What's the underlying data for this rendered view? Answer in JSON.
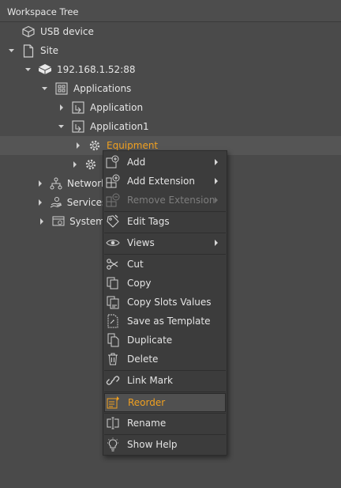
{
  "panel": {
    "title": "Workspace Tree"
  },
  "tree": {
    "usb_device": "USB device",
    "site": "Site",
    "device_ip": "192.168.1.52:88",
    "applications": "Applications",
    "application": "Application",
    "application1": "Application1",
    "equipment": "Equipment",
    "network": "Network",
    "services": "Services",
    "system": "System"
  },
  "context_menu": {
    "add": "Add",
    "add_extension": "Add Extension",
    "remove_extension": "Remove Extension",
    "edit_tags": "Edit Tags",
    "views": "Views",
    "cut": "Cut",
    "copy": "Copy",
    "copy_slots_values": "Copy Slots Values",
    "save_as_template": "Save as Template",
    "duplicate": "Duplicate",
    "delete": "Delete",
    "link_mark": "Link Mark",
    "reorder": "Reorder",
    "rename": "Rename",
    "show_help": "Show Help"
  },
  "colors": {
    "background": "#4a4a4a",
    "menu_background": "#3c3c3c",
    "highlight_text": "#f0a020",
    "text": "#e4e4e4",
    "disabled_text": "#7d7d7d"
  }
}
